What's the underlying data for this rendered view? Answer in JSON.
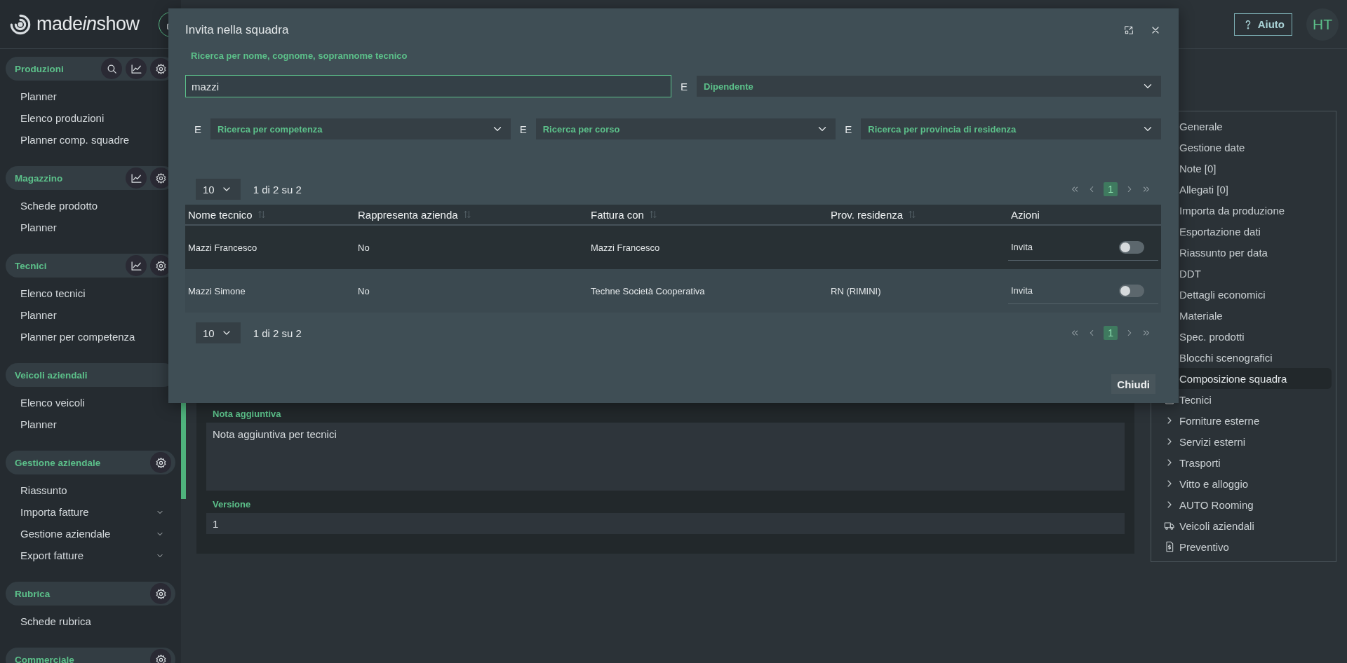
{
  "sidebar": {
    "logo": [
      "made",
      "in",
      "show"
    ],
    "sections": [
      {
        "title": "Produzioni",
        "actions": [
          {
            "kind": "search"
          },
          {
            "kind": "chart"
          },
          {
            "kind": "settings"
          }
        ],
        "items": [
          {
            "label": "Planner",
            "expandable": false
          },
          {
            "label": "Elenco produzioni",
            "expandable": false
          },
          {
            "label": "Planner comp. squadre",
            "expandable": false
          }
        ]
      },
      {
        "title": "Magazzino",
        "actions": [
          {
            "kind": "chart"
          },
          {
            "kind": "settings"
          }
        ],
        "items": [
          {
            "label": "Schede prodotto",
            "expandable": false
          },
          {
            "label": "Planner",
            "expandable": false
          }
        ]
      },
      {
        "title": "Tecnici",
        "actions": [
          {
            "kind": "chart"
          },
          {
            "kind": "settings"
          }
        ],
        "items": [
          {
            "label": "Elenco tecnici",
            "expandable": false
          },
          {
            "label": "Planner",
            "expandable": false
          },
          {
            "label": "Planner per competenza",
            "expandable": false
          }
        ]
      },
      {
        "title": "Veicoli aziendali",
        "items": [
          {
            "label": "Elenco veicoli",
            "expandable": false
          },
          {
            "label": "Planner",
            "expandable": false
          }
        ]
      },
      {
        "title": "Gestione aziendale",
        "actions": [
          {
            "kind": "settings"
          }
        ],
        "items": [
          {
            "label": "Riassunto",
            "expandable": false
          },
          {
            "label": "Importa fatture",
            "expandable": true
          },
          {
            "label": "Gestione aziendale",
            "expandable": true
          },
          {
            "label": "Export fatture",
            "expandable": true
          }
        ]
      },
      {
        "title": "Rubrica",
        "actions": [
          {
            "kind": "settings"
          }
        ],
        "items": [
          {
            "label": "Schede rubrica",
            "expandable": false
          }
        ]
      },
      {
        "title": "Commerciale",
        "actions": [
          {
            "kind": "settings"
          }
        ]
      }
    ]
  },
  "header": {
    "help_button": "Aiuto",
    "avatar": "HT"
  },
  "content": {
    "fields": [
      {
        "label": "Nota aggiuntiva",
        "value": "Nota aggiuntiva per tecnici",
        "kind": "textarea"
      },
      {
        "label": "Versione",
        "value": "1",
        "kind": "input"
      }
    ]
  },
  "side_nav": {
    "items": [
      {
        "label": "Generale",
        "kind": "plain",
        "selected": false
      },
      {
        "label": "Gestione date",
        "kind": "plain",
        "selected": false
      },
      {
        "label": "Note [0]",
        "kind": "plain",
        "selected": false
      },
      {
        "label": "Allegati [0]",
        "kind": "plain",
        "selected": false
      },
      {
        "label": "Importa da produzione",
        "kind": "plain",
        "selected": false
      },
      {
        "label": "Esportazione dati",
        "kind": "plain",
        "selected": false
      },
      {
        "label": "Riassunto per data",
        "kind": "plain",
        "selected": false
      },
      {
        "label": "DDT",
        "kind": "plain",
        "selected": false
      },
      {
        "label": "Dettagli economici",
        "kind": "plain",
        "selected": false
      },
      {
        "label": "Materiale",
        "kind": "plain",
        "selected": false
      },
      {
        "label": "Spec. prodotti",
        "kind": "plain",
        "selected": false
      },
      {
        "label": "Blocchi scenografici",
        "kind": "plain",
        "selected": false
      },
      {
        "label": "Composizione squadra",
        "kind": "plain",
        "selected": true
      },
      {
        "label": "Tecnici",
        "kind": "list",
        "selected": false
      },
      {
        "label": "Forniture esterne",
        "kind": "expandable",
        "selected": false
      },
      {
        "label": "Servizi esterni",
        "kind": "expandable",
        "selected": false
      },
      {
        "label": "Trasporti",
        "kind": "expandable",
        "selected": false
      },
      {
        "label": "Vitto e alloggio",
        "kind": "expandable",
        "selected": false
      },
      {
        "label": "AUTO Rooming",
        "kind": "expandable",
        "selected": false
      },
      {
        "label": "Veicoli aziendali",
        "kind": "vehicle",
        "selected": false
      },
      {
        "label": "Preventivo",
        "kind": "document",
        "selected": false
      }
    ]
  },
  "modal": {
    "title": "Invita nella squadra",
    "search_label": "Ricerca per nome, cognome, soprannome tecnico",
    "search_value": "mazzi",
    "first_filter": {
      "conjunction": "E",
      "label": "Dipendente"
    },
    "filters": [
      {
        "conjunction": "E",
        "label": "Ricerca per competenza"
      },
      {
        "conjunction": "E",
        "label": "Ricerca per corso"
      },
      {
        "conjunction": "E",
        "label": "Ricerca per provincia di residenza"
      }
    ],
    "pagination_top": {
      "page_size": "10",
      "info": "1 di 2 su 2",
      "current_page": "1"
    },
    "columns": [
      {
        "label": "Nome tecnico",
        "sortable": true
      },
      {
        "label": "Rappresenta azienda",
        "sortable": true
      },
      {
        "label": "Fattura con",
        "sortable": true
      },
      {
        "label": "Prov. residenza",
        "sortable": true
      },
      {
        "label": "Azioni",
        "sortable": false
      }
    ],
    "rows": [
      {
        "cells": [
          "Mazzi Francesco",
          "No",
          "Mazzi Francesco"
        ],
        "action": {
          "label": "Invita",
          "on": false
        }
      },
      {
        "cells": [
          "Mazzi Simone",
          "No",
          "Techne Società Cooperativa",
          "RN (RIMINI)"
        ],
        "action": {
          "label": "Invita",
          "on": false
        }
      }
    ],
    "pagination_bottom": {
      "page_size": "10",
      "info": "1 di 2 su 2",
      "current_page": "1"
    },
    "close_button": "Chiudi"
  }
}
